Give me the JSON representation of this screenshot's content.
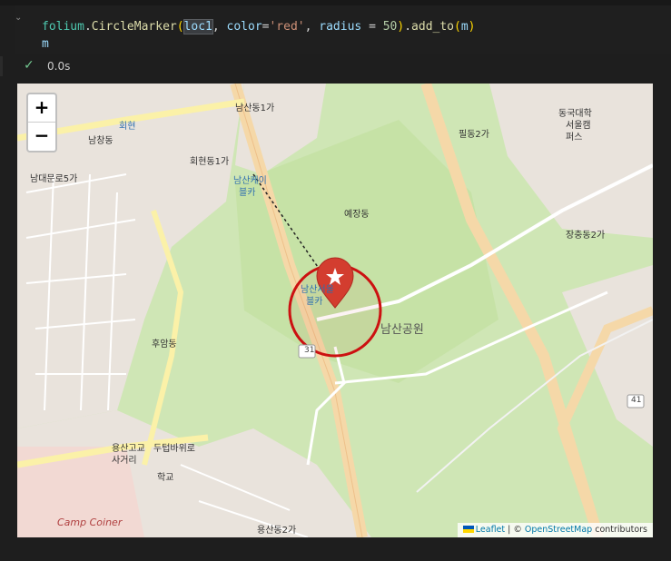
{
  "code": {
    "line1": {
      "module": "folium",
      "dot": ".",
      "func": "CircleMarker",
      "open": "(",
      "arg1": "loc1",
      "comma1": ", ",
      "param1": "color",
      "eq1": "=",
      "val1": "'red'",
      "comma2": ", ",
      "param2": "radius",
      "eq2": " = ",
      "val2": "50",
      "close": ")",
      "dot2": ".",
      "func2": "add_to",
      "open2": "(",
      "arg2": "m",
      "close2": ")"
    },
    "line2": "m"
  },
  "status": {
    "elapsed": "0.0s"
  },
  "map": {
    "zoom_in": "+",
    "zoom_out": "−",
    "attribution": {
      "leaflet": "Leaflet",
      "sep": " | © ",
      "osm": "OpenStreetMap",
      "suffix": " contributors"
    },
    "labels": {
      "namsandong1": "남산동1가",
      "hoehyeondong1": "회현동1가",
      "hoehyeon": "회현",
      "namchang": "남창동",
      "namdaemun5": "남대문로5가",
      "cable1": "남산케이",
      "cable2": "블카",
      "yejangdong": "예장동",
      "pildong2": "필동2가",
      "dongguk1": "동국대학",
      "dongguk2": "서울캠",
      "dongguk3": "퍼스",
      "jangchung2": "장충동2가",
      "namsanpark": "남산공원",
      "huam": "후암동",
      "yongsan1": "용산고교",
      "yongsan2": "두텁바위로",
      "yongsan3": "사거리",
      "school": "학교",
      "campcoiner": "Camp Coiner",
      "yongsan2ga": "용산동2가",
      "route31": "31",
      "route41": "41",
      "station1": "남산서울",
      "station2": "블카"
    },
    "marker_color": "#cc1111"
  }
}
